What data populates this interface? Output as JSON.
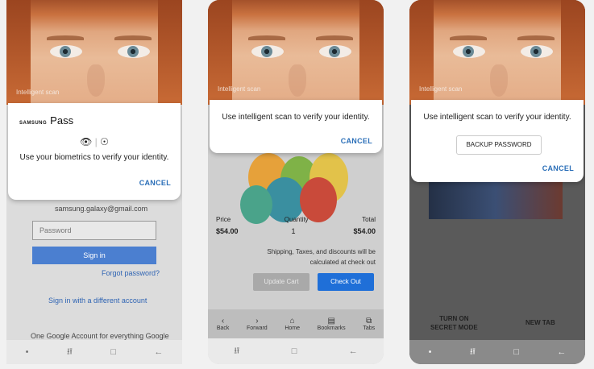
{
  "screen1": {
    "brand": "Intelligent scan",
    "samsung": "SAMSUNG",
    "pass": "Pass",
    "biometric_icons": "👁 | ☉",
    "message": "Use your biometrics to verify your identity.",
    "cancel": "CANCEL",
    "email": "samsung.galaxy@gmail.com",
    "password_placeholder": "Password",
    "signin": "Sign in",
    "forgot": "Forgot password?",
    "different_account": "Sign in with a different account",
    "footer": "One Google Account for everything Google"
  },
  "screen2": {
    "brand": "Intelligent scan",
    "message": "Use intelligent scan to verify your identity.",
    "cancel": "CANCEL",
    "price_label": "Price",
    "quantity_label": "Quantity",
    "total_label": "Total",
    "price": "$54.00",
    "quantity": "1",
    "total": "$54.00",
    "note_line1": "Shipping, Taxes, and discounts will be",
    "note_line2": "calculated at check out",
    "update_cart": "Update Cart",
    "check_out": "Check Out",
    "tabs": [
      {
        "icon": "‹",
        "label": "Back"
      },
      {
        "icon": "›",
        "label": "Forward"
      },
      {
        "icon": "⌂",
        "label": "Home"
      },
      {
        "icon": "▤",
        "label": "Bookmarks"
      },
      {
        "icon": "⧉",
        "label": "Tabs"
      }
    ]
  },
  "screen3": {
    "brand": "Intelligent scan",
    "message": "Use intelligent scan to verify your identity.",
    "backup_password": "BACKUP PASSWORD",
    "cancel": "CANCEL",
    "secret_line1": "TURN ON",
    "secret_line2": "SECRET MODE",
    "new_tab": "NEW TAB"
  },
  "navbar": {
    "dot": "•",
    "recents": "⭿",
    "home": "□",
    "back": "←"
  },
  "colors": {
    "accent": "#2b6fb8",
    "checkout_blue": "#1f6fd8",
    "signin_blue": "#4b7fd0"
  }
}
